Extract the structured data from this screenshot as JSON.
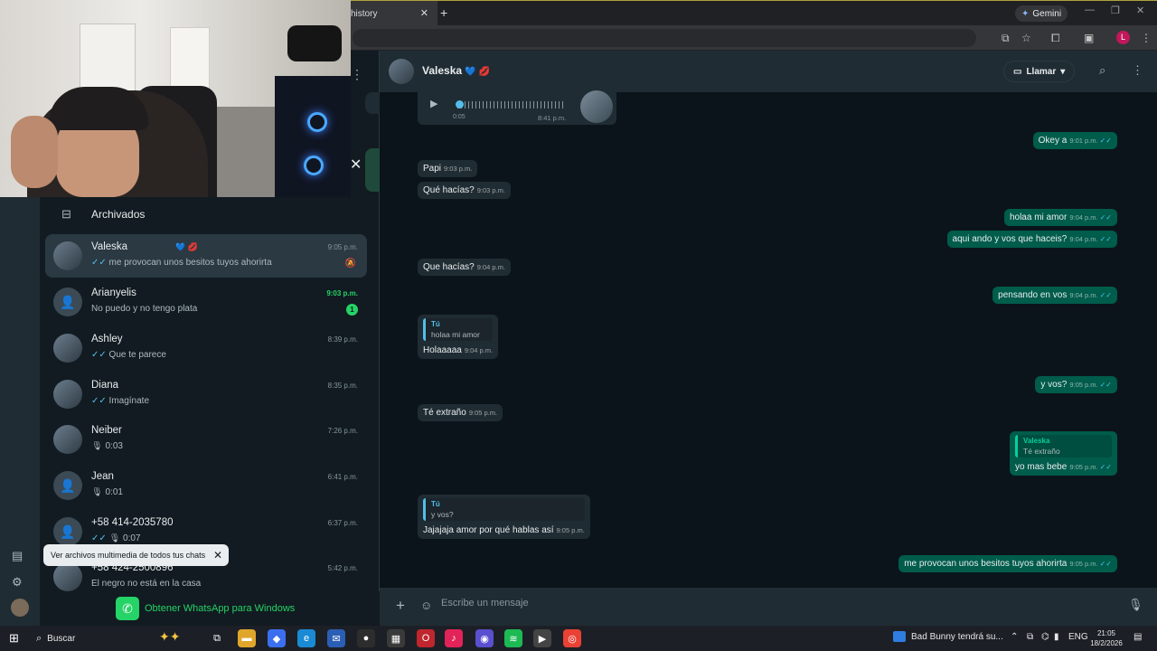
{
  "browser": {
    "tab_title": "History",
    "tab_title_visible": "history",
    "new_tab": "+",
    "gemini_label": "Gemini",
    "profile_initial": "L"
  },
  "sidebar": {
    "archived_label": "Archivados",
    "chats": [
      {
        "name": "Valeska",
        "name_suffix": "💙 💋",
        "time": "9:05 p.m.",
        "preview": "me provocan unos besitos tuyos ahorirta",
        "read": true,
        "muted": true,
        "active": true
      },
      {
        "name": "Arianyelis",
        "time": "9:03 p.m.",
        "preview": "No puedo y no tengo plata",
        "unread_count": "1",
        "unread": true
      },
      {
        "name": "Ashley",
        "time": "8:39 p.m.",
        "preview": "Que te parece",
        "read": true
      },
      {
        "name": "Diana",
        "time": "8:35 p.m.",
        "preview": "Imagínate",
        "read": true
      },
      {
        "name": "Neiber",
        "time": "7:26 p.m.",
        "preview": "0:03",
        "voice": true
      },
      {
        "name": "Jean",
        "time": "6:41 p.m.",
        "preview": "0:01",
        "voice": true
      },
      {
        "name": "+58 414-2035780",
        "time": "6:37 p.m.",
        "preview": "0:07",
        "voice": true,
        "read": true
      },
      {
        "name": "+58 424-2500896",
        "time": "5:42 p.m.",
        "preview": "Él negro no está en la casa"
      }
    ],
    "tooltip": "Ver archivos multimedia de todos tus chats",
    "get_whatsapp": "Obtener WhatsApp para Windows"
  },
  "conversation": {
    "contact_name": "Valeska",
    "contact_suffix": "💙 💋",
    "call_label": "Llamar",
    "voice_note": {
      "duration": "0:05",
      "time": "8:41 p.m."
    },
    "messages": [
      {
        "dir": "out",
        "text": "Okey a",
        "time": "9:01 p.m."
      },
      {
        "dir": "in",
        "text": "Papi",
        "time": "9:03 p.m."
      },
      {
        "dir": "in",
        "text": "Qué hacías?",
        "time": "9:03 p.m."
      },
      {
        "dir": "out",
        "text": "holaa mi amor",
        "time": "9:04 p.m."
      },
      {
        "dir": "out",
        "text": "aqui ando y vos que haceis?",
        "time": "9:04 p.m."
      },
      {
        "dir": "in",
        "text": "Que hacías?",
        "time": "9:04 p.m."
      },
      {
        "dir": "out",
        "text": "pensando en vos",
        "time": "9:04 p.m."
      },
      {
        "dir": "in",
        "text": "Holaaaaa",
        "time": "9:04 p.m.",
        "quote_author": "Tú",
        "quote_text": "holaa mi amor"
      },
      {
        "dir": "out",
        "text": "y vos?",
        "time": "9:05 p.m."
      },
      {
        "dir": "in",
        "text": "Té extraño",
        "time": "9:05 p.m."
      },
      {
        "dir": "out",
        "text": "yo mas bebe",
        "time": "9:05 p.m.",
        "quote_author": "Valeska",
        "quote_text": "Té extraño"
      },
      {
        "dir": "in",
        "text": "Jajajaja amor por qué hablas así",
        "time": "9:05 p.m.",
        "quote_author": "Tú",
        "quote_text": "y vos?"
      },
      {
        "dir": "out",
        "text": "me provocan unos besitos tuyos ahorirta",
        "time": "9:05 p.m."
      }
    ],
    "composer_placeholder": "Escribe un mensaje"
  },
  "taskbar": {
    "search_label": "Buscar",
    "news_label": "Bad Bunny tendrá su...",
    "language": "ENG",
    "time": "21:05",
    "date": "18/2/2026"
  },
  "colors": {
    "accent_green": "#25d366",
    "outgoing_bubble": "#005c4b",
    "incoming_bubble": "#202c33",
    "read_tick": "#53bdeb"
  }
}
